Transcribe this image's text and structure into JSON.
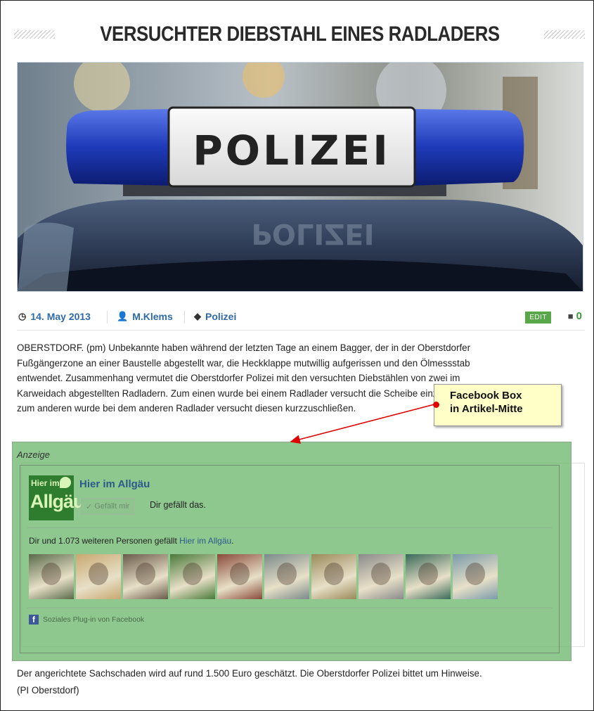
{
  "article": {
    "title": "VERSUCHTER DIEBSTAHL EINES RADLADERS",
    "hero_sign": "POLIZEI",
    "hero_reflection": "POLIZEI",
    "meta": {
      "date": "14. May 2013",
      "author": "M.Klems",
      "category": "Polizei",
      "edit_label": "EDIT",
      "comment_count": "0"
    },
    "paragraph1_lines": [
      "OBERSTDORF. (pm) Unbekannte haben während der letzten Tage an einem Bagger, der in der Oberstdorfer",
      "Fußgängerzone an einer Baustelle abgestellt war, die Heckklappe mutwillig aufgerissen und den Ölmessstab",
      "entwendet. Zusammenhang vermutet die Oberstdorfer Polizei mit den versuchten Diebstählen von zwei im",
      "Karweidach abgestellten Radladern. Zum einen wurde bei einem Radlader versucht die Scheibe einzuschlagen und",
      "zum anderen wurde bei dem anderen Radlader versucht diesen kurzzuschließen."
    ],
    "paragraph2_lines": [
      "Der angerichtete Sachschaden wird auf rund 1.500 Euro geschätzt. Die Oberstdorfer Polizei bittet um Hinweise.",
      "(PI Oberstdorf)"
    ]
  },
  "callout": {
    "line1": "Facebook Box",
    "line2": "in Artikel-Mitte"
  },
  "ad": {
    "label": "Anzeige",
    "fb": {
      "logo_line1": "Hier im",
      "logo_line2": "Allgäu",
      "page_name": "Hier im Allgäu",
      "like_button": "Gefällt mir",
      "you_like": "Dir gefällt das.",
      "count_text": "Dir und 1.073 weiteren Personen gefällt ",
      "count_link": "Hier im Allgäu",
      "count_end": ".",
      "plugin_label": "Soziales Plug-in von Facebook",
      "faces": [
        "#5a6b4a",
        "#c8a870",
        "#6a5a4a",
        "#4a7a3a",
        "#8a4a3a",
        "#7a8a8a",
        "#9a8a5a",
        "#8a8a8a",
        "#3a6a5a",
        "#7a9aaa"
      ]
    }
  },
  "colors": {
    "link": "#2f6aa8",
    "ad_overlay": "#6eb96e",
    "callout_bg": "#ffffc8",
    "arrow": "#e00000"
  }
}
